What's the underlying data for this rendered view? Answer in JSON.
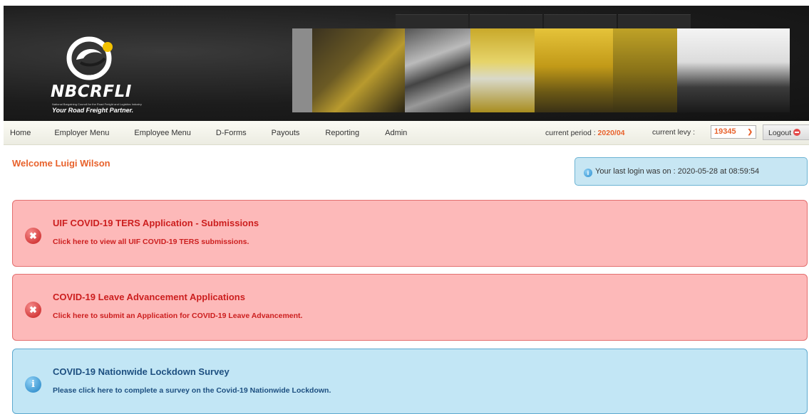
{
  "brand": {
    "name": "NBCRFLI",
    "subtitle": "National Bargaining Council for the Road Freight and Logistics Industry",
    "tagline": "Your Road Freight Partner."
  },
  "nav": {
    "items": [
      "Home",
      "Employer Menu",
      "Employee Menu",
      "D-Forms",
      "Payouts",
      "Reporting",
      "Admin"
    ],
    "period_label": "current period :",
    "period_value": "2020/04",
    "levy_label": "current levy :",
    "levy_value": "19345",
    "logout_label": "Logout"
  },
  "welcome": "Welcome Luigi Wilson",
  "last_login": "Your last login was on : 2020-05-28 at 08:59:54",
  "alerts": [
    {
      "type": "error",
      "title": "UIF COVID-19 TERS Application - Submissions",
      "link": "Click here to view all UIF COVID-19 TERS submissions."
    },
    {
      "type": "error",
      "title": "COVID-19 Leave Advancement Applications",
      "link": "Click here to submit an Application for COVID-19 Leave Advancement."
    },
    {
      "type": "info",
      "title": "COVID-19 Nationwide Lockdown Survey",
      "link": "Please click here to complete a survey on the Covid-19 Nationwide Lockdown."
    }
  ],
  "icons": {
    "error": "x-circle-icon",
    "info": "info-circle-icon",
    "logout": "minus-circle-icon",
    "levy_dropdown": "chevron-down-icon"
  },
  "colors": {
    "accent": "#e8622c",
    "error_bg": "#fdb9b9",
    "error_text": "#cc1e1e",
    "info_bg": "#c2e6f5",
    "info_text": "#1d4f80"
  }
}
